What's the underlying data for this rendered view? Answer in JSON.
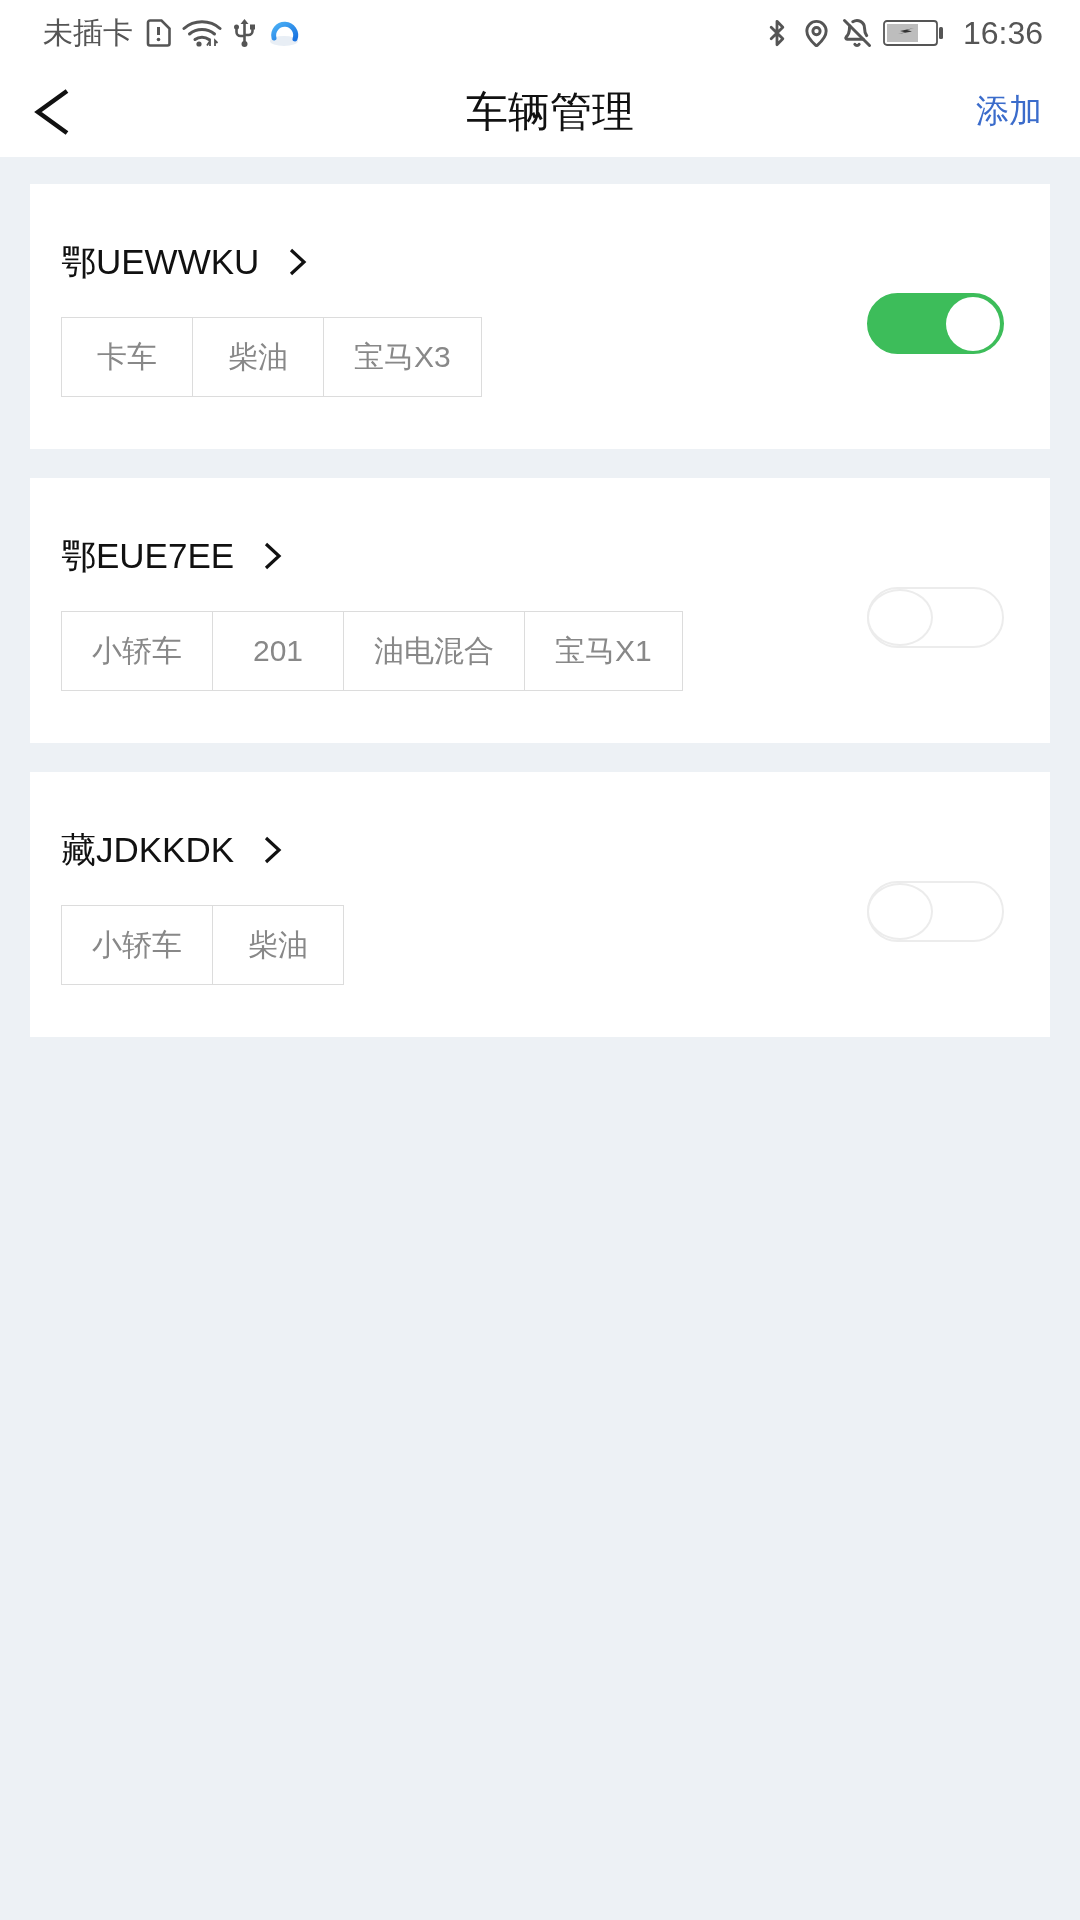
{
  "status_bar": {
    "carrier": "未插卡",
    "time": "16:36"
  },
  "header": {
    "title": "车辆管理",
    "action": "添加"
  },
  "vehicles": [
    {
      "plate": "鄂UEWWKU",
      "tags": [
        "卡车",
        "柴油",
        "宝马X3"
      ],
      "on": true
    },
    {
      "plate": "鄂EUE7EE",
      "tags": [
        "小轿车",
        "201",
        "油电混合",
        "宝马X1"
      ],
      "on": false
    },
    {
      "plate": "藏JDKKDK",
      "tags": [
        "小轿车",
        "柴油"
      ],
      "on": false
    }
  ]
}
